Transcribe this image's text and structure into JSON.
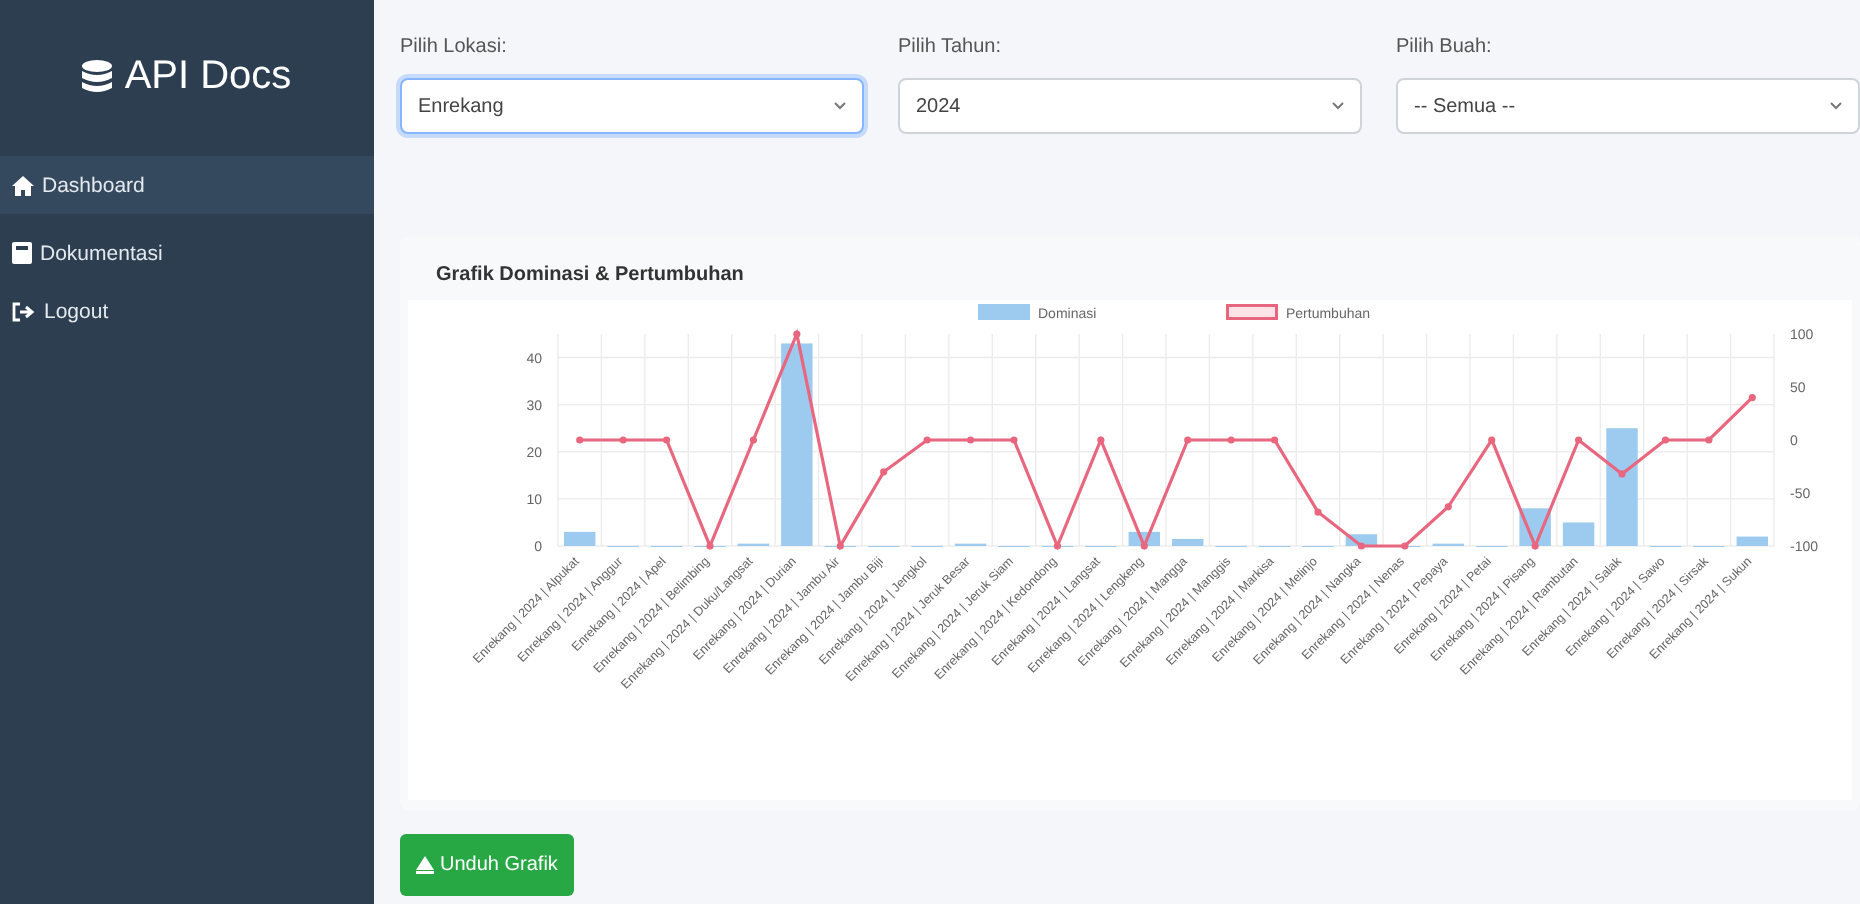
{
  "sidebar": {
    "brand": "API Docs",
    "items": [
      {
        "label": "Dashboard",
        "selected": true
      },
      {
        "label": "Dokumentasi",
        "selected": false
      },
      {
        "label": "Logout",
        "selected": false
      }
    ]
  },
  "filters": [
    {
      "label": "Pilih Lokasi:",
      "value": "Enrekang",
      "focused": true
    },
    {
      "label": "Pilih Tahun:",
      "value": "2024",
      "focused": false
    },
    {
      "label": "Pilih Buah:",
      "value": "-- Semua --",
      "focused": false
    }
  ],
  "chart_card": {
    "title": "Grafik Dominasi & Pertumbuhan",
    "chart_data": {
      "type": "bar",
      "legend": "top",
      "grid": true,
      "categories": [
        "Enrekang | 2024 | Alpukat",
        "Enrekang | 2024 | Anggur",
        "Enrekang | 2024 | Apel",
        "Enrekang | 2024 | Belimbing",
        "Enrekang | 2024 | Duku/Langsat",
        "Enrekang | 2024 | Durian",
        "Enrekang | 2024 | Jambu Air",
        "Enrekang | 2024 | Jambu Biji",
        "Enrekang | 2024 | Jengkol",
        "Enrekang | 2024 | Jeruk Besar",
        "Enrekang | 2024 | Jeruk Siam",
        "Enrekang | 2024 | Kedondong",
        "Enrekang | 2024 | Langsat",
        "Enrekang | 2024 | Lengkeng",
        "Enrekang | 2024 | Mangga",
        "Enrekang | 2024 | Manggis",
        "Enrekang | 2024 | Markisa",
        "Enrekang | 2024 | Melinjo",
        "Enrekang | 2024 | Nangka",
        "Enrekang | 2024 | Nenas",
        "Enrekang | 2024 | Pepaya",
        "Enrekang | 2024 | Petai",
        "Enrekang | 2024 | Pisang",
        "Enrekang | 2024 | Rambutan",
        "Enrekang | 2024 | Salak",
        "Enrekang | 2024 | Sawo",
        "Enrekang | 2024 | Sirsak",
        "Enrekang | 2024 | Sukun"
      ],
      "series": [
        {
          "name": "Dominasi",
          "color": "#9ccbef",
          "values": [
            3,
            0,
            0,
            0,
            0.5,
            43,
            0,
            0,
            0,
            0.5,
            0,
            0,
            0,
            3,
            1.5,
            0,
            0,
            0,
            2.5,
            0,
            0.5,
            0,
            8,
            5,
            25,
            0,
            0,
            2
          ]
        }
      ],
      "ylim": [
        0,
        45
      ],
      "yticks": [
        0,
        10,
        20,
        30,
        40
      ]
    },
    "overlay": {
      "chart_data": {
        "type": "line",
        "legend": "top",
        "categories": [
          null,
          null,
          null,
          null,
          null,
          null,
          null,
          null,
          null,
          null,
          null,
          null,
          null,
          null,
          null,
          null,
          null,
          null,
          null,
          null,
          null,
          null,
          null,
          null,
          null,
          null,
          null,
          null
        ],
        "series": [
          {
            "name": "Pertumbuhan",
            "color": "#e8677f",
            "marker": "circle",
            "values": [
              0,
              0,
              0,
              -100,
              0,
              100,
              -100,
              -30,
              0,
              0,
              0,
              -100,
              0,
              -100,
              0,
              0,
              0,
              -68,
              -100,
              -100,
              -63,
              0,
              -100,
              0,
              -32,
              0,
              0,
              40
            ]
          }
        ],
        "ylim": [
          -100,
          100
        ],
        "yticks": [
          -100,
          -50,
          0,
          50,
          100
        ]
      }
    }
  },
  "download_button": {
    "label": "Unduh Grafik"
  }
}
